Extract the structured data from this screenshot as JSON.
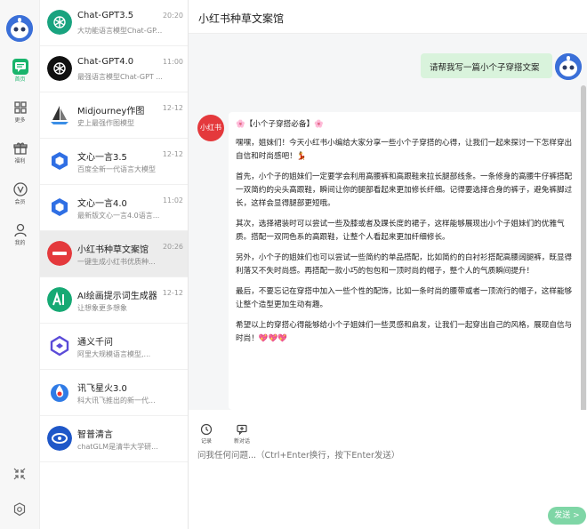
{
  "nav": {
    "items": [
      {
        "label": "首页",
        "icon": "chat-icon"
      },
      {
        "label": "更多",
        "icon": "grid-icon"
      },
      {
        "label": "福利",
        "icon": "gift-icon"
      },
      {
        "label": "会员",
        "icon": "vip-icon"
      },
      {
        "label": "我的",
        "icon": "user-icon"
      }
    ],
    "accent": "#19b46c"
  },
  "conversations": [
    {
      "name": "Chat-GPT3.5",
      "time": "20:20",
      "desc": "大功能语言模型Chat-GP..."
    },
    {
      "name": "Chat-GPT4.0",
      "time": "11:00",
      "desc": "最强语言模型Chat-GPT ..."
    },
    {
      "name": "Midjourney作图",
      "time": "12-12",
      "desc": "史上最强作图模型"
    },
    {
      "name": "文心一言3.5",
      "time": "12-12",
      "desc": "百度全新一代语言大模型"
    },
    {
      "name": "文心一言4.0",
      "time": "11:02",
      "desc": "最新版文心一言4.0语言..."
    },
    {
      "name": "小红书种草文案馆",
      "time": "20:26",
      "desc": "一键生成小红书优质种..."
    },
    {
      "name": "AI绘画提示词生成器",
      "time": "12-12",
      "desc": "让想象更多想象"
    },
    {
      "name": "通义千问",
      "time": "",
      "desc": "阿里大规模语言模型,..."
    },
    {
      "name": "讯飞星火3.0",
      "time": "",
      "desc": "科大讯飞推出的新一代..."
    },
    {
      "name": "智普清言",
      "time": "",
      "desc": "chatGLM是清华大学研..."
    }
  ],
  "header": {
    "title": "小红书种草文案馆"
  },
  "chat": {
    "user_message": "请帮我写一篇小个子穿搭文案",
    "bot_avatar_text": "小红书",
    "bot_message": [
      "🌸【小个子穿搭必备】🌸",
      "嘿嘿，姐妹们！今天小红书小编给大家分享一些小个子穿搭的心得，让我们一起来探讨一下怎样穿出自信和时尚感吧！💃",
      "首先，小个子的姐妹们一定要学会利用高腰裤和高跟鞋来拉长腿部线条。一条修身的高腰牛仔裤搭配一双简约的尖头高跟鞋，瞬间让你的腿部看起来更加修长纤细。记得要选择合身的裤子，避免裤脚过长，这样会显得腿部更短哦。",
      "其次，选择裙装时可以尝试一些及膝或者及踝长度的裙子，这样能够展现出小个子姐妹们的优雅气质。搭配一双同色系的高跟鞋，让整个人看起来更加纤细修长。",
      "另外，小个子的姐妹们也可以尝试一些简约的单品搭配，比如简约的白衬衫搭配高腰阔腿裤，既显得利落又不失时尚感。再搭配一款小巧的包包和一顶时尚的帽子，整个人的气质瞬间提升！",
      "最后，不要忘记在穿搭中加入一些个性的配饰，比如一条时尚的腰带或者一顶流行的帽子，这样能够让整个造型更加生动有趣。",
      "希望以上的穿搭心得能够给小个子姐妹们一些灵感和启发，让我们一起穿出自己的风格，展现自信与时尚！💖💖💖"
    ]
  },
  "composer": {
    "tools": [
      {
        "label": "记录",
        "icon": "clock-icon"
      },
      {
        "label": "新对话",
        "icon": "new-chat-icon"
      }
    ],
    "placeholder": "问我任何问题...（Ctrl+Enter换行，按下Enter发送）",
    "send_label": "发送 >"
  }
}
